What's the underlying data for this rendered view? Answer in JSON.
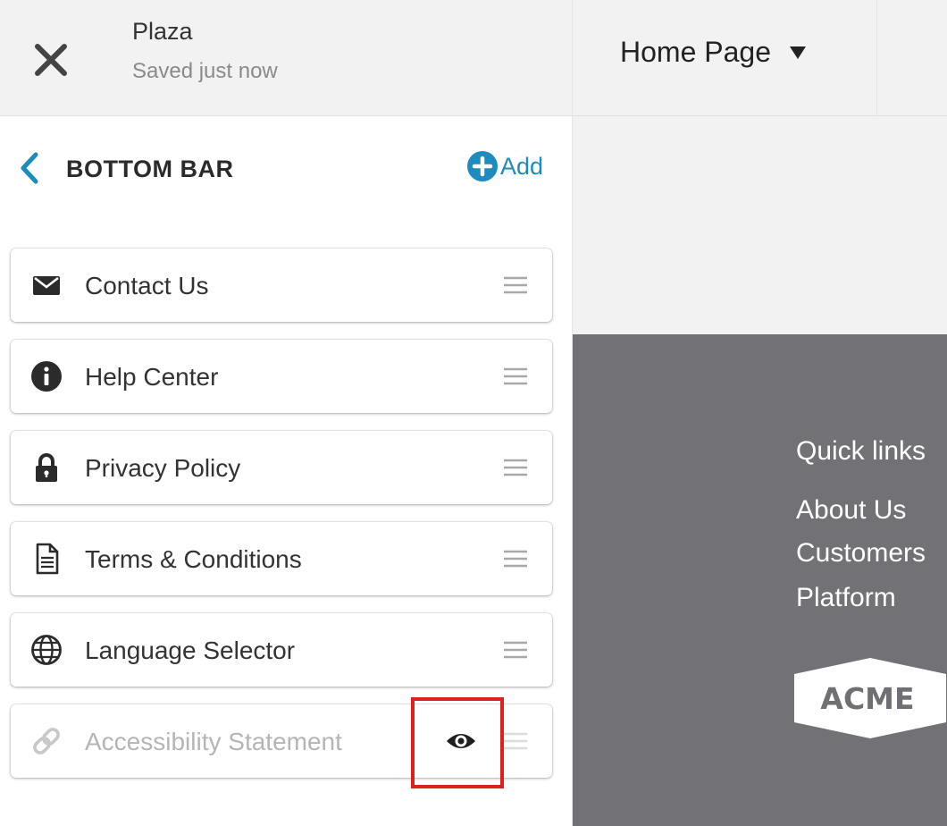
{
  "header": {
    "site_name": "Plaza",
    "save_status": "Saved just now"
  },
  "section": {
    "title": "BOTTOM BAR",
    "add_label": "Add"
  },
  "items": [
    {
      "label": "Contact Us",
      "icon": "envelope-icon",
      "visible": true
    },
    {
      "label": "Help Center",
      "icon": "info-icon",
      "visible": true
    },
    {
      "label": "Privacy Policy",
      "icon": "lock-icon",
      "visible": true
    },
    {
      "label": "Terms & Conditions",
      "icon": "document-icon",
      "visible": true
    },
    {
      "label": "Language Selector",
      "icon": "globe-icon",
      "visible": true
    },
    {
      "label": "Accessibility Statement",
      "icon": "link-icon",
      "visible": false
    }
  ],
  "preview": {
    "page_selector_label": "Home Page",
    "footer": {
      "quick_links_title": "Quick links",
      "links": [
        "About Us",
        "Customers",
        "Platform"
      ],
      "logo_text": "ACME"
    }
  },
  "colors": {
    "accent": "#1e8bbd",
    "footer_bg": "#717176",
    "highlight": "#e0201c"
  }
}
